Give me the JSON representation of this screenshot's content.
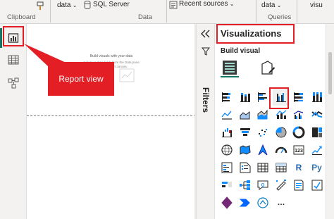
{
  "ribbon": {
    "data_btn": "data",
    "sql_btn": "SQL Server",
    "recent_btn": "Recent sources",
    "visual_btn": "data",
    "visual_trunc": "visu",
    "groups": {
      "clipboard": "Clipboard",
      "data": "Data",
      "queries": "Queries"
    },
    "icons": [
      "format-painter-icon",
      "database-icon",
      "recent-sources-icon",
      "chevron-down-icon"
    ]
  },
  "left_rail": {
    "items": [
      {
        "name": "report-view",
        "icon": "bar-chart-icon",
        "active": true
      },
      {
        "name": "table-view",
        "icon": "table-grid-icon",
        "active": false
      },
      {
        "name": "model-view",
        "icon": "model-icon",
        "active": false
      }
    ],
    "accent": "#117865"
  },
  "canvas": {
    "placeholder_title": "Build visuals with your data",
    "placeholder_line1": "Select or drag fields from the Data pane",
    "placeholder_line2": "onto the report canvas.",
    "bg": "#ffffff"
  },
  "annotation": {
    "label": "Report view",
    "color": "#e31e24"
  },
  "filters": {
    "label": "Filters",
    "collapse_icon": "double-chevron-left-icon",
    "filter_icon": "funnel-icon"
  },
  "viz_pane": {
    "title": "Visualizations",
    "build_visual": "Build visual",
    "modes": [
      "build-visual-icon",
      "format-visual-icon"
    ],
    "visuals": [
      "stacked-bar-chart",
      "stacked-column-chart",
      "clustered-bar-chart",
      "clustered-column-chart",
      "100-percent-stacked-bar-chart",
      "100-percent-stacked-column-chart",
      "line-chart",
      "area-chart",
      "stacked-area-chart",
      "line-and-stacked-column-chart",
      "line-and-clustered-column-chart",
      "ribbon-chart",
      "waterfall-chart",
      "funnel-chart",
      "scatter-chart",
      "pie-chart",
      "donut-chart",
      "treemap",
      "map",
      "filled-map",
      "azure-map",
      "gauge",
      "card",
      "kpi",
      "multi-row-card",
      "slicer",
      "table",
      "matrix",
      "r-visual",
      "python-visual",
      "key-influencers",
      "decomposition-tree",
      "q-and-a",
      "smart-narrative",
      "paginated-report",
      "metrics",
      "power-apps",
      "power-automate",
      "arcgis-map",
      "more-visuals"
    ],
    "text_cells": {
      "r-visual": "R",
      "python-visual": "Py"
    },
    "highlighted": "clustered-column-chart"
  },
  "colors": {
    "accent_teal": "#117865",
    "blue": "#118dff",
    "navy": "#12239e",
    "red": "#e31e24",
    "ribbon_bg": "#f3f2f1"
  }
}
